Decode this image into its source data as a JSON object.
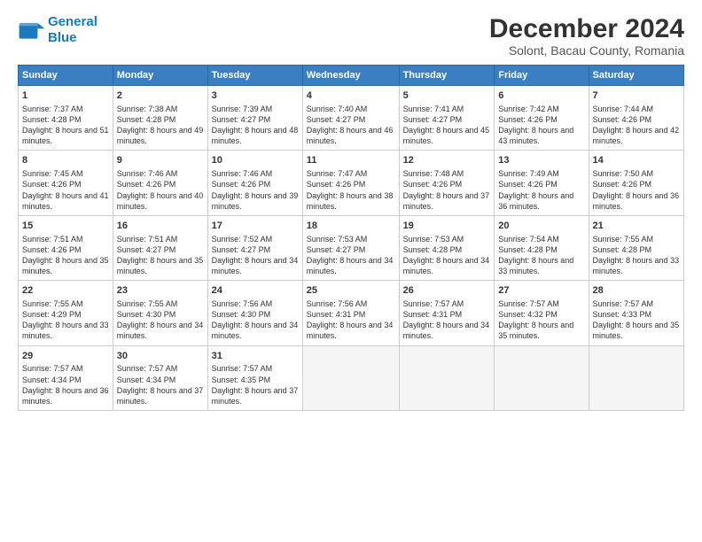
{
  "logo": {
    "line1": "General",
    "line2": "Blue"
  },
  "title": "December 2024",
  "subtitle": "Solont, Bacau County, Romania",
  "days_of_week": [
    "Sunday",
    "Monday",
    "Tuesday",
    "Wednesday",
    "Thursday",
    "Friday",
    "Saturday"
  ],
  "weeks": [
    [
      {
        "day": 1,
        "sunrise": "7:37 AM",
        "sunset": "4:28 PM",
        "daylight": "8 hours and 51 minutes."
      },
      {
        "day": 2,
        "sunrise": "7:38 AM",
        "sunset": "4:28 PM",
        "daylight": "8 hours and 49 minutes."
      },
      {
        "day": 3,
        "sunrise": "7:39 AM",
        "sunset": "4:27 PM",
        "daylight": "8 hours and 48 minutes."
      },
      {
        "day": 4,
        "sunrise": "7:40 AM",
        "sunset": "4:27 PM",
        "daylight": "8 hours and 46 minutes."
      },
      {
        "day": 5,
        "sunrise": "7:41 AM",
        "sunset": "4:27 PM",
        "daylight": "8 hours and 45 minutes."
      },
      {
        "day": 6,
        "sunrise": "7:42 AM",
        "sunset": "4:26 PM",
        "daylight": "8 hours and 43 minutes."
      },
      {
        "day": 7,
        "sunrise": "7:44 AM",
        "sunset": "4:26 PM",
        "daylight": "8 hours and 42 minutes."
      }
    ],
    [
      {
        "day": 8,
        "sunrise": "7:45 AM",
        "sunset": "4:26 PM",
        "daylight": "8 hours and 41 minutes."
      },
      {
        "day": 9,
        "sunrise": "7:46 AM",
        "sunset": "4:26 PM",
        "daylight": "8 hours and 40 minutes."
      },
      {
        "day": 10,
        "sunrise": "7:46 AM",
        "sunset": "4:26 PM",
        "daylight": "8 hours and 39 minutes."
      },
      {
        "day": 11,
        "sunrise": "7:47 AM",
        "sunset": "4:26 PM",
        "daylight": "8 hours and 38 minutes."
      },
      {
        "day": 12,
        "sunrise": "7:48 AM",
        "sunset": "4:26 PM",
        "daylight": "8 hours and 37 minutes."
      },
      {
        "day": 13,
        "sunrise": "7:49 AM",
        "sunset": "4:26 PM",
        "daylight": "8 hours and 36 minutes."
      },
      {
        "day": 14,
        "sunrise": "7:50 AM",
        "sunset": "4:26 PM",
        "daylight": "8 hours and 36 minutes."
      }
    ],
    [
      {
        "day": 15,
        "sunrise": "7:51 AM",
        "sunset": "4:26 PM",
        "daylight": "8 hours and 35 minutes."
      },
      {
        "day": 16,
        "sunrise": "7:51 AM",
        "sunset": "4:27 PM",
        "daylight": "8 hours and 35 minutes."
      },
      {
        "day": 17,
        "sunrise": "7:52 AM",
        "sunset": "4:27 PM",
        "daylight": "8 hours and 34 minutes."
      },
      {
        "day": 18,
        "sunrise": "7:53 AM",
        "sunset": "4:27 PM",
        "daylight": "8 hours and 34 minutes."
      },
      {
        "day": 19,
        "sunrise": "7:53 AM",
        "sunset": "4:28 PM",
        "daylight": "8 hours and 34 minutes."
      },
      {
        "day": 20,
        "sunrise": "7:54 AM",
        "sunset": "4:28 PM",
        "daylight": "8 hours and 33 minutes."
      },
      {
        "day": 21,
        "sunrise": "7:55 AM",
        "sunset": "4:28 PM",
        "daylight": "8 hours and 33 minutes."
      }
    ],
    [
      {
        "day": 22,
        "sunrise": "7:55 AM",
        "sunset": "4:29 PM",
        "daylight": "8 hours and 33 minutes."
      },
      {
        "day": 23,
        "sunrise": "7:55 AM",
        "sunset": "4:30 PM",
        "daylight": "8 hours and 34 minutes."
      },
      {
        "day": 24,
        "sunrise": "7:56 AM",
        "sunset": "4:30 PM",
        "daylight": "8 hours and 34 minutes."
      },
      {
        "day": 25,
        "sunrise": "7:56 AM",
        "sunset": "4:31 PM",
        "daylight": "8 hours and 34 minutes."
      },
      {
        "day": 26,
        "sunrise": "7:57 AM",
        "sunset": "4:31 PM",
        "daylight": "8 hours and 34 minutes."
      },
      {
        "day": 27,
        "sunrise": "7:57 AM",
        "sunset": "4:32 PM",
        "daylight": "8 hours and 35 minutes."
      },
      {
        "day": 28,
        "sunrise": "7:57 AM",
        "sunset": "4:33 PM",
        "daylight": "8 hours and 35 minutes."
      }
    ],
    [
      {
        "day": 29,
        "sunrise": "7:57 AM",
        "sunset": "4:34 PM",
        "daylight": "8 hours and 36 minutes."
      },
      {
        "day": 30,
        "sunrise": "7:57 AM",
        "sunset": "4:34 PM",
        "daylight": "8 hours and 37 minutes."
      },
      {
        "day": 31,
        "sunrise": "7:57 AM",
        "sunset": "4:35 PM",
        "daylight": "8 hours and 37 minutes."
      },
      null,
      null,
      null,
      null
    ]
  ]
}
